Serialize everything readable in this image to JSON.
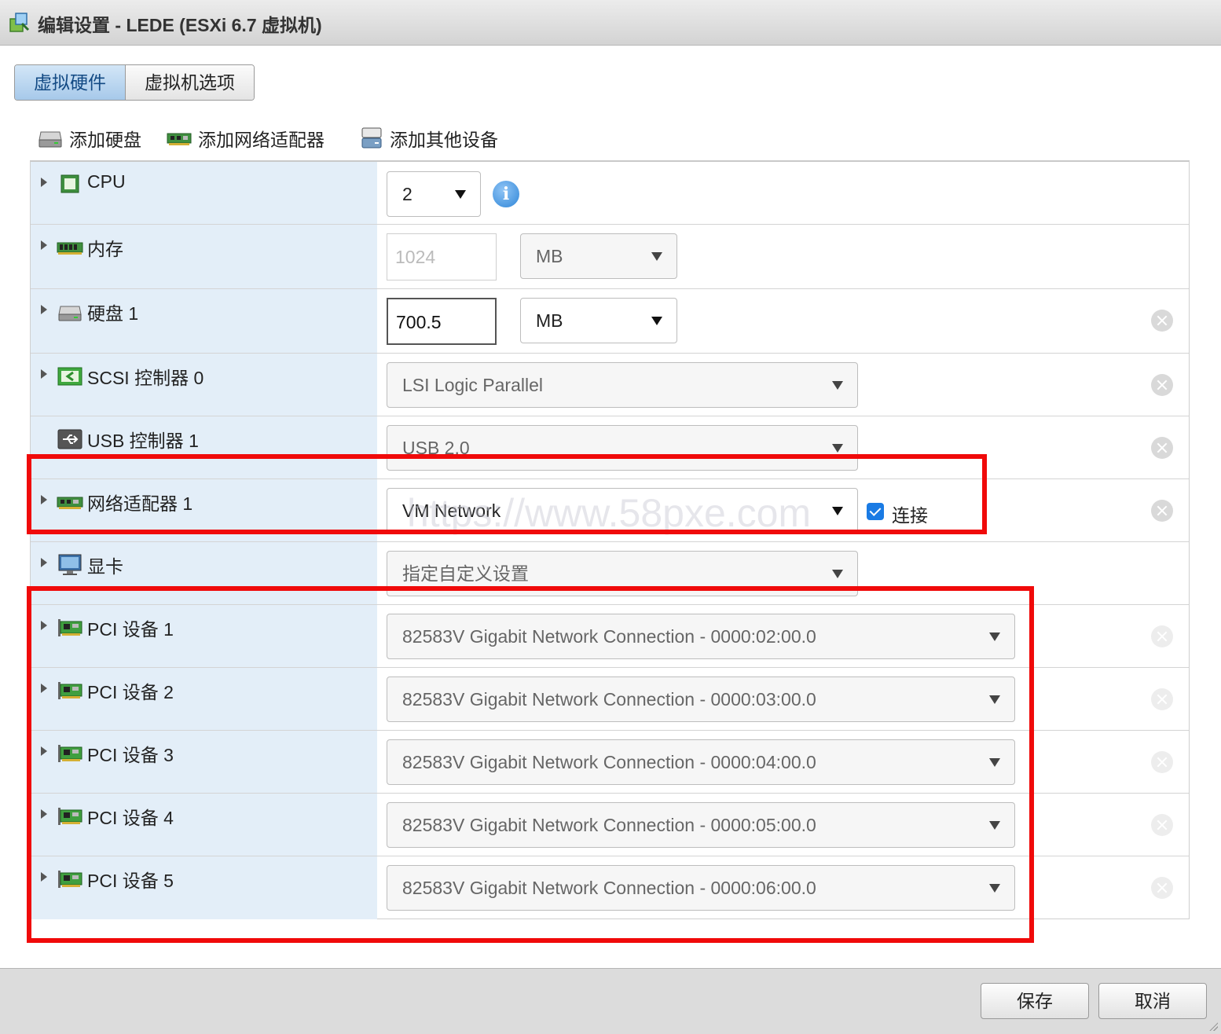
{
  "window": {
    "title": "编辑设置 - LEDE (ESXi 6.7 虚拟机)"
  },
  "tabs": [
    {
      "label": "虚拟硬件",
      "active": true
    },
    {
      "label": "虚拟机选项",
      "active": false
    }
  ],
  "toolbar": {
    "add_disk": "添加硬盘",
    "add_network_adapter": "添加网络适配器",
    "add_other_device": "添加其他设备"
  },
  "hardware": {
    "cpu": {
      "label": "CPU",
      "value": "2"
    },
    "memory": {
      "label": "内存",
      "value": "1024",
      "unit": "MB"
    },
    "disk1": {
      "label": "硬盘 1",
      "value": "700.5",
      "unit": "MB"
    },
    "scsi0": {
      "label": "SCSI 控制器 0",
      "value": "LSI Logic Parallel"
    },
    "usb1": {
      "label": "USB 控制器 1",
      "value": "USB 2.0"
    },
    "net1": {
      "label": "网络适配器 1",
      "value": "VM Network",
      "connect_label": "连接",
      "connected": true
    },
    "video": {
      "label": "显卡",
      "value": "指定自定义设置"
    },
    "pci": [
      {
        "label": "PCI 设备 1",
        "value": "82583V Gigabit Network Connection - 0000:02:00.0"
      },
      {
        "label": "PCI 设备 2",
        "value": "82583V Gigabit Network Connection - 0000:03:00.0"
      },
      {
        "label": "PCI 设备 3",
        "value": "82583V Gigabit Network Connection - 0000:04:00.0"
      },
      {
        "label": "PCI 设备 4",
        "value": "82583V Gigabit Network Connection - 0000:05:00.0"
      },
      {
        "label": "PCI 设备 5",
        "value": "82583V Gigabit Network Connection - 0000:06:00.0"
      }
    ]
  },
  "watermark": "https://www.58pxe.com",
  "footer": {
    "save": "保存",
    "cancel": "取消"
  },
  "colors": {
    "highlight": "#f00a0a",
    "active_tab": "#a7c9ea",
    "label_cell": "#e3eef8",
    "checkbox": "#1a7be4"
  }
}
